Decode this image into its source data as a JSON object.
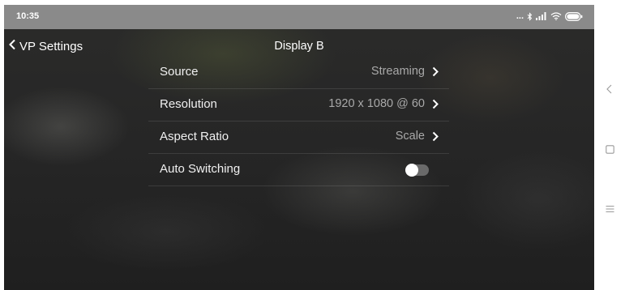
{
  "status_bar": {
    "time": "10:35",
    "dots": "..."
  },
  "header": {
    "back_label": "VP Settings",
    "title": "Display B"
  },
  "settings": [
    {
      "label": "Source",
      "value": "Streaming",
      "type": "disclosure"
    },
    {
      "label": "Resolution",
      "value": "1920 x 1080 @ 60",
      "type": "disclosure"
    },
    {
      "label": "Aspect Ratio",
      "value": "Scale",
      "type": "disclosure"
    },
    {
      "label": "Auto Switching",
      "type": "toggle",
      "enabled": false
    }
  ],
  "icons": {
    "back": "chevron-left-icon",
    "disclosure": "chevron-right-icon",
    "status": [
      "bluetooth-icon",
      "signal-icon",
      "wifi-icon",
      "battery-icon"
    ],
    "system_nav": [
      "back-triangle-icon",
      "home-square-icon",
      "menu-lines-icon"
    ]
  },
  "colors": {
    "status_bar": "#8a8a8a",
    "label": "#f0f0f0",
    "value": "#a9a9a9",
    "toggle_track": "#6a6a6a",
    "toggle_knob": "#ffffff"
  }
}
